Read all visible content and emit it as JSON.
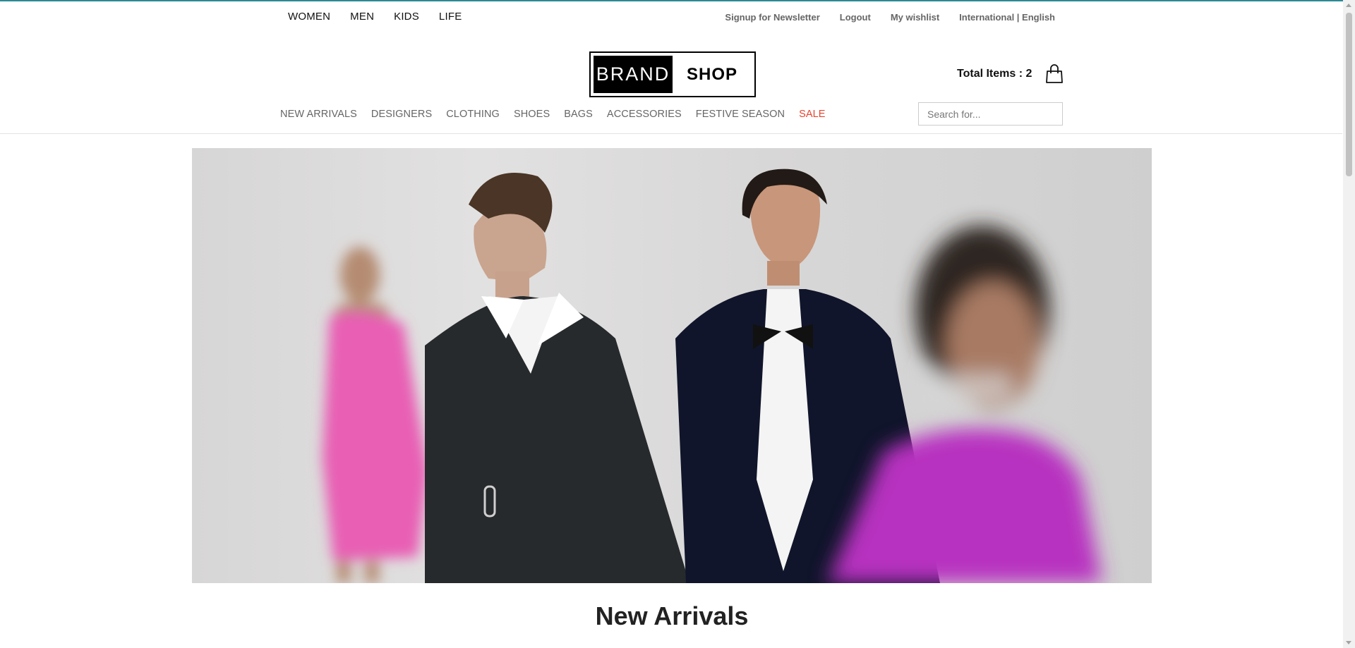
{
  "top_nav": {
    "genders": [
      "WOMEN",
      "MEN",
      "KIDS",
      "LIFE"
    ],
    "utility": [
      "Signup for Newsletter",
      "Logout",
      "My wishlist",
      "International | English"
    ]
  },
  "logo": {
    "left": "BRAND",
    "right": "SHOP"
  },
  "cart": {
    "label": "Total Items : 2",
    "icon": "shopping-bag-icon"
  },
  "categories": [
    "NEW ARRIVALS",
    "DESIGNERS",
    "CLOTHING",
    "SHOES",
    "BAGS",
    "ACCESSORIES",
    "FESTIVE SEASON",
    "SALE"
  ],
  "search": {
    "placeholder": "Search for...",
    "icon": "search-icon"
  },
  "main": {
    "section_title": "New Arrivals"
  },
  "colors": {
    "accent_line": "#2a8a95",
    "sale": "#e8432e"
  }
}
